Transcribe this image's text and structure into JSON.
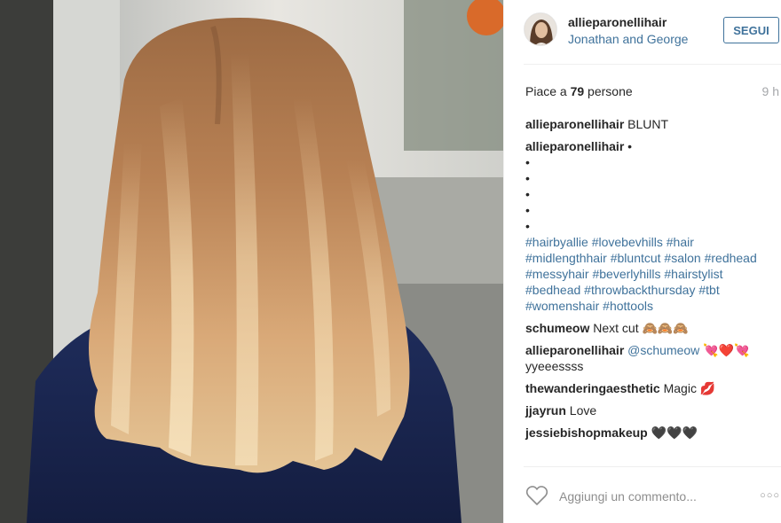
{
  "post": {
    "username": "allieparonellihair",
    "location": "Jonathan and George",
    "follow_label": "SEGUI",
    "likes_prefix": "Piace a ",
    "likes_count": "79",
    "likes_suffix": " persone",
    "time": "9 h",
    "caption": {
      "user": "allieparonellihair",
      "text": "BLUNT"
    },
    "hashtag_comment": {
      "user": "allieparonellihair",
      "first": "•",
      "dots": [
        "•",
        "•",
        "•",
        "•",
        "•"
      ],
      "hashtags": "#hairbyallie #lovebevhills #hair #midlengthhair #bluntcut #salon #redhead #messyhair #beverlyhills #hairstylist #bedhead #throwbackthursday #tbt #womenshair #hottools"
    },
    "comments": [
      {
        "user": "schumeow",
        "text": "Next cut 🙈🙈🙈"
      },
      {
        "user": "allieparonellihair",
        "mention": "@schumeow",
        "text": "💘❤️💘 yyeeessss"
      },
      {
        "user": "thewanderingaesthetic",
        "text": "Magic 💋"
      },
      {
        "user": "jjayrun",
        "text": "Love"
      },
      {
        "user": "jessiebishopmakeup",
        "text": "🖤🖤🖤"
      }
    ],
    "add_comment_placeholder": "Aggiungi un commento...",
    "more_label": "○○○"
  },
  "icons": {
    "like": "heart-outline-icon",
    "options": "more-options-icon",
    "avatar": "profile-photo"
  },
  "colors": {
    "link": "#3f729b",
    "text": "#262626",
    "muted": "#a5a7aa"
  }
}
